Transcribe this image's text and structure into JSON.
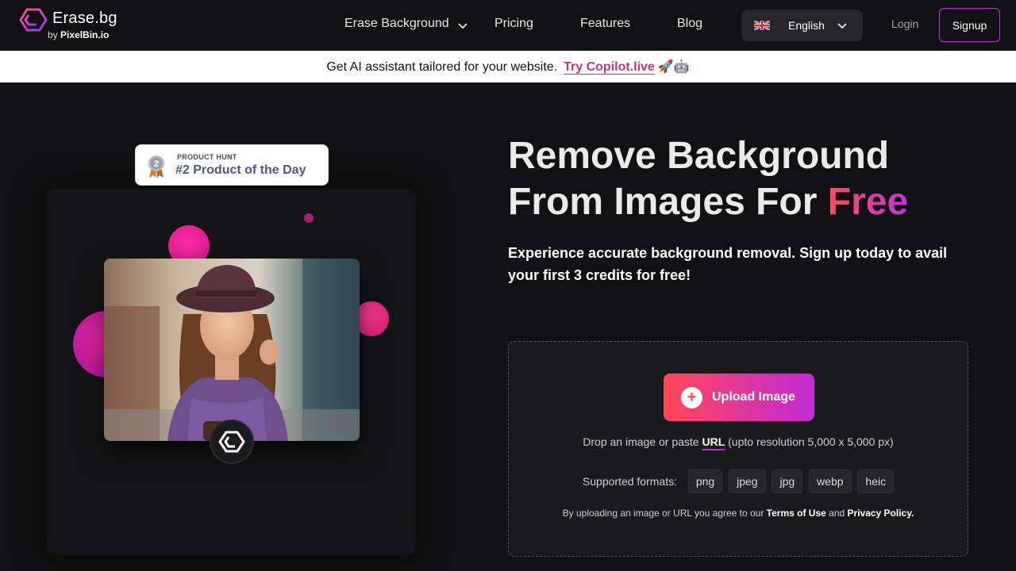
{
  "header": {
    "logo_name": "Erase.bg",
    "logo_by": "by",
    "logo_by_brand": "PixelBin.io",
    "nav": {
      "erase_background": "Erase Background",
      "pricing": "Pricing",
      "features": "Features",
      "blog": "Blog"
    },
    "language": "English",
    "login": "Login",
    "signup": "Signup"
  },
  "banner": {
    "text": "Get AI assistant tailored for your website.",
    "link": "Try Copilot.live",
    "emoji": "🚀🤖"
  },
  "product_hunt": {
    "small": "PRODUCT HUNT",
    "big": "#2 Product of the Day",
    "rank": "2"
  },
  "hero": {
    "title_line1": "Remove Background",
    "title_line2": "From Images For ",
    "title_highlight": "Free",
    "subtitle": "Experience accurate background removal. Sign up today to avail your first 3 credits for free!"
  },
  "upload": {
    "button": "Upload Image",
    "drop_prefix": "Drop an image or paste ",
    "drop_link": "URL",
    "drop_suffix": " (upto resolution 5,000 x 5,000 px)",
    "formats_label": "Supported formats:",
    "formats": [
      "png",
      "jpeg",
      "jpg",
      "webp",
      "heic"
    ],
    "terms_prefix": "By uploading an image or URL you agree to our ",
    "terms_link": "Terms of Use",
    "terms_and": " and ",
    "privacy_link": "Privacy Policy."
  },
  "colors": {
    "accent_start": "#ff4757",
    "accent_end": "#c22ad6",
    "background": "#111113",
    "banner_link": "#c2367f"
  }
}
